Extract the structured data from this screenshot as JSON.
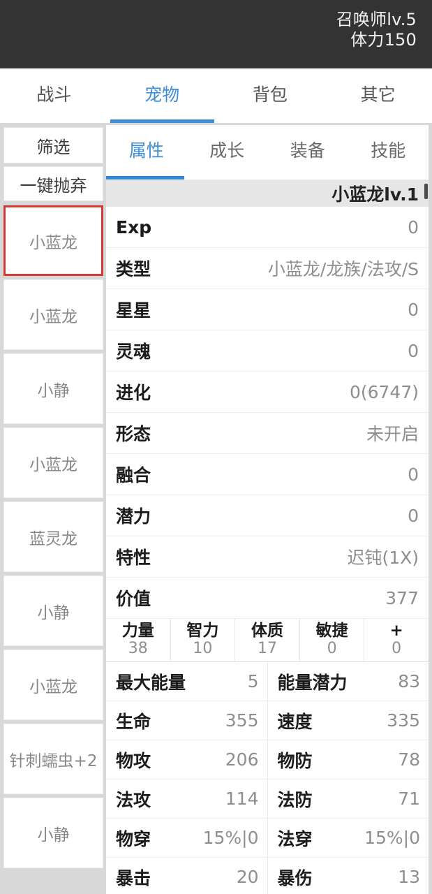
{
  "statusbar": {
    "line1": "召唤师lv.5",
    "line2": "体力150"
  },
  "top_tabs": [
    {
      "label": "战斗",
      "active": false
    },
    {
      "label": "宠物",
      "active": true
    },
    {
      "label": "背包",
      "active": false
    },
    {
      "label": "其它",
      "active": false
    }
  ],
  "sidebar": {
    "filter_label": "筛选",
    "discard_label": "一键抛弃",
    "pets": [
      {
        "name": "小蓝龙",
        "selected": true
      },
      {
        "name": "小蓝龙",
        "selected": false
      },
      {
        "name": "小静",
        "selected": false
      },
      {
        "name": "小蓝龙",
        "selected": false
      },
      {
        "name": "蓝灵龙",
        "selected": false
      },
      {
        "name": "小静",
        "selected": false
      },
      {
        "name": "小蓝龙",
        "selected": false
      },
      {
        "name": "针刺蠕虫+2",
        "selected": false
      },
      {
        "name": "小静",
        "selected": false
      }
    ]
  },
  "sub_tabs": [
    {
      "label": "属性",
      "active": true
    },
    {
      "label": "成长",
      "active": false
    },
    {
      "label": "装备",
      "active": false
    },
    {
      "label": "技能",
      "active": false
    }
  ],
  "pet_detail": {
    "header": "小蓝龙lv.1",
    "attributes": [
      {
        "label": "Exp",
        "value": "0"
      },
      {
        "label": "类型",
        "value": "小蓝龙/龙族/法攻/S"
      },
      {
        "label": "星星",
        "value": "0"
      },
      {
        "label": "灵魂",
        "value": "0"
      },
      {
        "label": "进化",
        "value": "0(6747)"
      },
      {
        "label": "形态",
        "value": "未开启"
      },
      {
        "label": "融合",
        "value": "0"
      },
      {
        "label": "潜力",
        "value": "0"
      },
      {
        "label": "特性",
        "value": "迟钝(1X)"
      },
      {
        "label": "价值",
        "value": "377"
      }
    ],
    "base_stats": [
      {
        "name": "力量",
        "value": "38"
      },
      {
        "name": "智力",
        "value": "10"
      },
      {
        "name": "体质",
        "value": "17"
      },
      {
        "name": "敏捷",
        "value": "0"
      },
      {
        "name": "+",
        "value": "0"
      }
    ],
    "paired_stats": [
      [
        {
          "label": "最大能量",
          "value": "5"
        },
        {
          "label": "能量潜力",
          "value": "83"
        }
      ],
      [
        {
          "label": "生命",
          "value": "355"
        },
        {
          "label": "速度",
          "value": "335"
        }
      ],
      [
        {
          "label": "物攻",
          "value": "206"
        },
        {
          "label": "物防",
          "value": "78"
        }
      ],
      [
        {
          "label": "法攻",
          "value": "114"
        },
        {
          "label": "法防",
          "value": "71"
        }
      ],
      [
        {
          "label": "物穿",
          "value": "15%|0"
        },
        {
          "label": "法穿",
          "value": "15%|0"
        }
      ],
      [
        {
          "label": "暴击",
          "value": "20"
        },
        {
          "label": "暴伤",
          "value": "13"
        }
      ]
    ]
  },
  "colors": {
    "accent": "#3d8fd6",
    "selected_border": "#d33a36",
    "statusbar_bg": "#333333",
    "header_bg": "#e6e6e6"
  }
}
